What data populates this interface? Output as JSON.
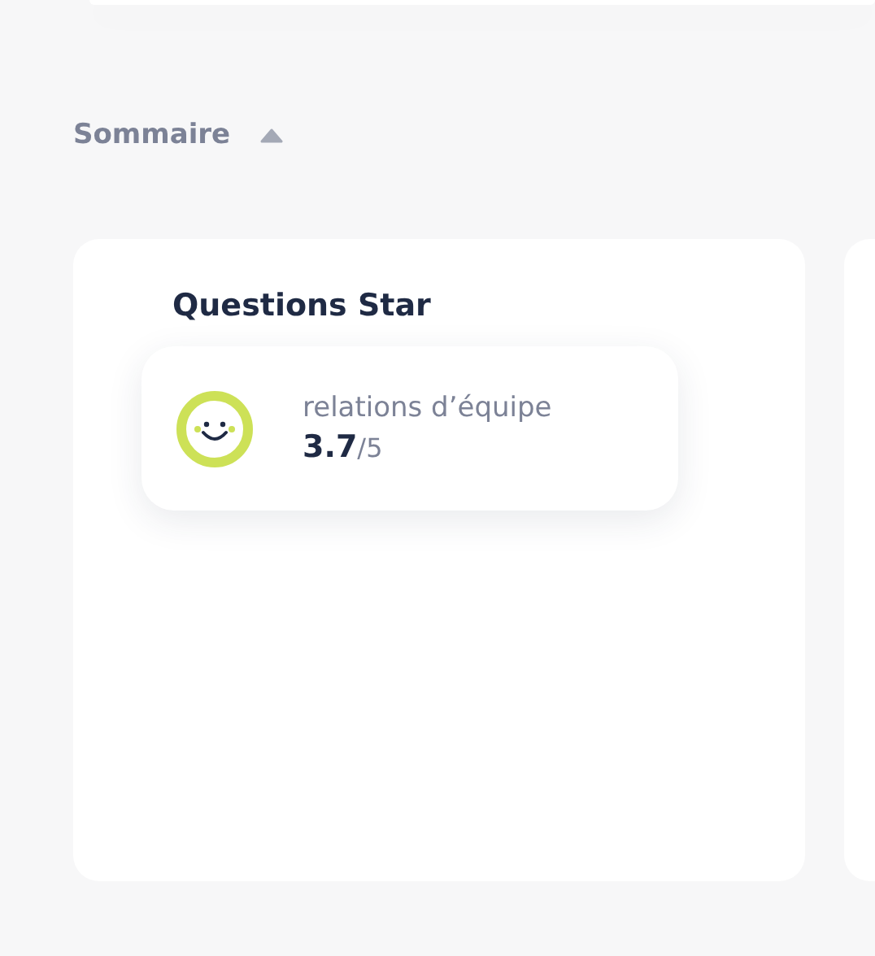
{
  "summary": {
    "title": "Sommaire",
    "expanded": true
  },
  "cards": [
    {
      "title": "Questions Star",
      "items": [
        {
          "label": "relations d’équipe",
          "score": "**3.7**/5"
        }
      ]
    }
  ]
}
